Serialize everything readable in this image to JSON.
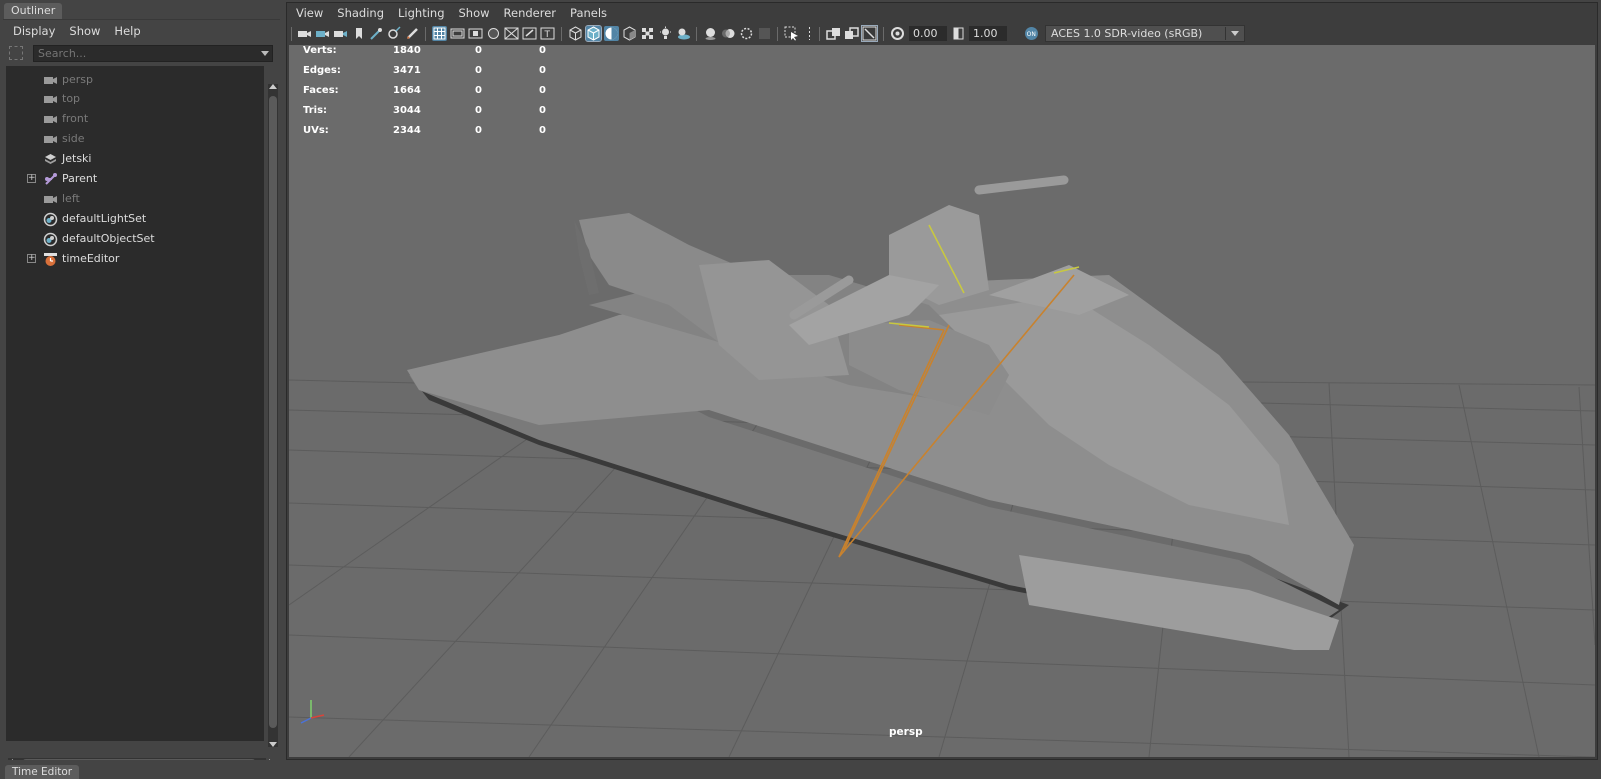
{
  "outliner": {
    "tab_label": "Outliner",
    "menu": [
      "Display",
      "Show",
      "Help"
    ],
    "search_placeholder": "Search...",
    "nodes": [
      {
        "label": "persp",
        "icon": "camera-icon",
        "dim": true,
        "expandable": false
      },
      {
        "label": "top",
        "icon": "camera-icon",
        "dim": true,
        "expandable": false
      },
      {
        "label": "front",
        "icon": "camera-icon",
        "dim": true,
        "expandable": false
      },
      {
        "label": "side",
        "icon": "camera-icon",
        "dim": true,
        "expandable": false
      },
      {
        "label": "Jetski",
        "icon": "mesh-icon",
        "dim": false,
        "expandable": false
      },
      {
        "label": "Parent",
        "icon": "joint-icon",
        "dim": false,
        "expandable": true
      },
      {
        "label": "left",
        "icon": "camera-icon",
        "dim": true,
        "expandable": false
      },
      {
        "label": "defaultLightSet",
        "icon": "set-icon",
        "dim": false,
        "expandable": false
      },
      {
        "label": "defaultObjectSet",
        "icon": "set-icon",
        "dim": false,
        "expandable": false
      },
      {
        "label": "timeEditor",
        "icon": "time-editor-icon",
        "dim": false,
        "expandable": true
      }
    ]
  },
  "viewport": {
    "menu": [
      "View",
      "Shading",
      "Lighting",
      "Show",
      "Renderer",
      "Panels"
    ],
    "exposure_value": "0.00",
    "gamma_value": "1.00",
    "color_space": "ACES 1.0 SDR-video (sRGB)",
    "camera_label": "persp",
    "hud": [
      {
        "label": "Verts:",
        "values": [
          "1840",
          "0",
          "0"
        ]
      },
      {
        "label": "Edges:",
        "values": [
          "3471",
          "0",
          "0"
        ]
      },
      {
        "label": "Faces:",
        "values": [
          "1664",
          "0",
          "0"
        ]
      },
      {
        "label": "Tris:",
        "values": [
          "3044",
          "0",
          "0"
        ]
      },
      {
        "label": "UVs:",
        "values": [
          "2344",
          "0",
          "0"
        ]
      }
    ]
  },
  "bottom": {
    "time_editor_tab": "Time Editor"
  },
  "colors": {
    "panel_bg": "#444444",
    "viewport_bg": "#6b6b6b",
    "active_tool": "#5285a6",
    "grid_line": "#5a5a5a",
    "mesh_gray": "#8e8e8e",
    "rig_orange": "#c8822e",
    "rig_yellow": "#c8c840"
  }
}
